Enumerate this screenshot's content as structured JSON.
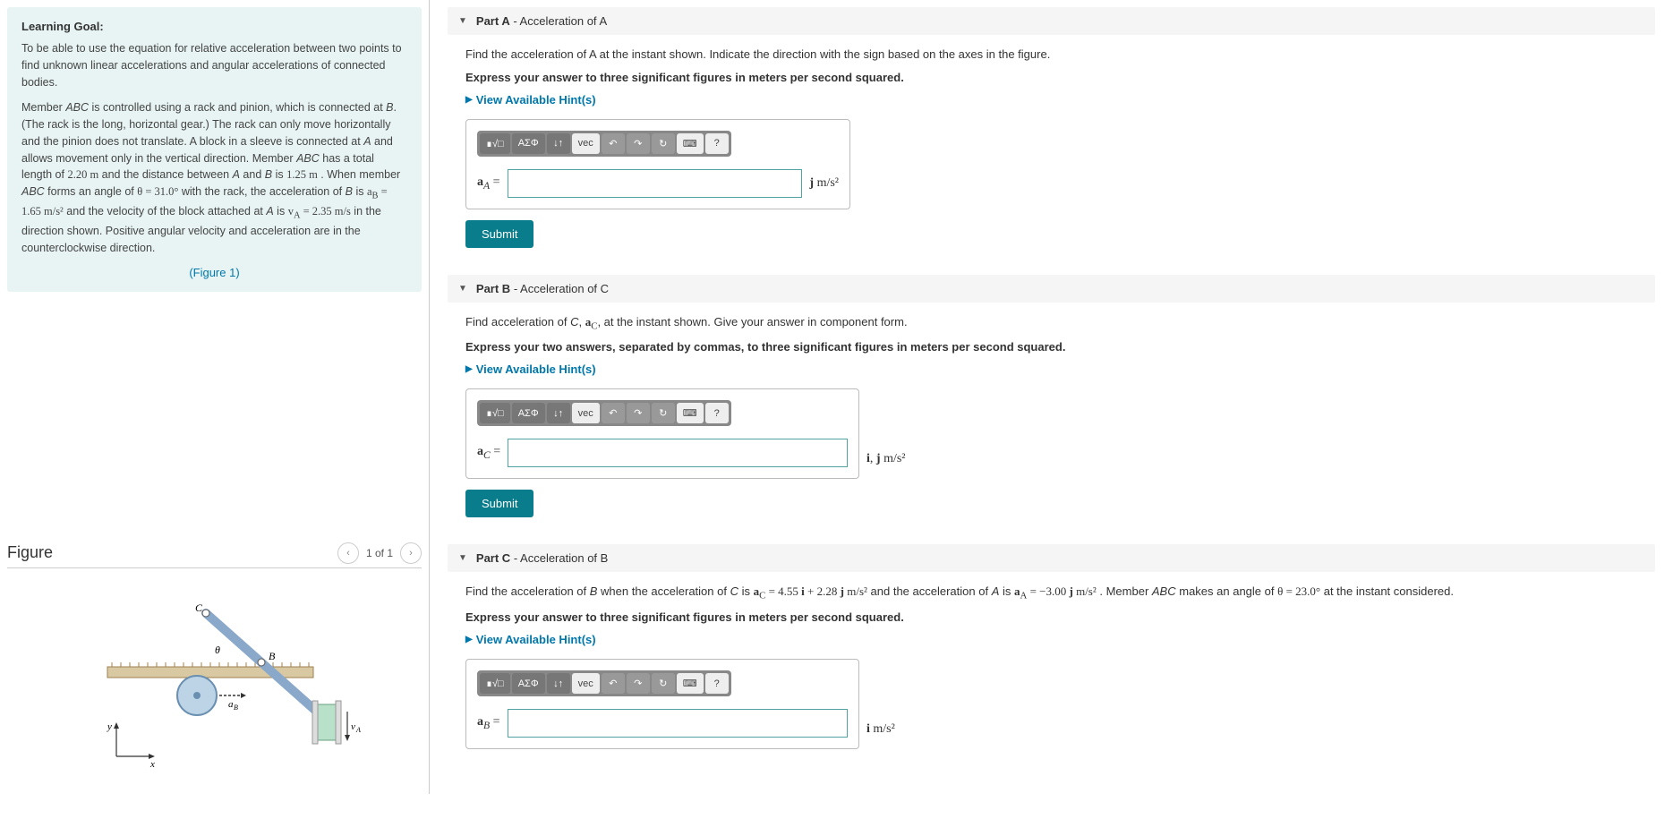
{
  "learning_goal": {
    "heading": "Learning Goal:",
    "p1": "To be able to use the equation for relative acceleration between two points to find unknown linear accelerations and angular accelerations of connected bodies.",
    "p2_html": "Member <i>ABC</i> is controlled using a rack and pinion, which is connected at <i>B</i>. (The rack is the long, horizontal gear.) The rack can only move horizontally and the pinion does not translate. A block in a sleeve is connected at <i>A</i> and allows movement only in the vertical direction. Member <i>ABC</i> has a total length of <span class='math'>2.20 m</span> and the distance between <i>A</i> and <i>B</i> is <span class='math'>1.25 m</span> . When member <i>ABC</i> forms an angle of <span class='math'>θ = 31.0°</span> with the rack, the acceleration of <i>B</i> is <span class='math'>a<sub>B</sub> = 1.65 m/s²</span> and the velocity of the block attached at <i>A</i> is <span class='math'>v<sub>A</sub> = 2.35 m/s</span> in the direction shown. Positive angular velocity and acceleration are in the counterclockwise direction.",
    "figure_link": "(Figure 1)"
  },
  "figure": {
    "title": "Figure",
    "nav_text": "1 of 1"
  },
  "toolbar": {
    "tmpl": "∎√□",
    "greek": "ΑΣΦ",
    "arrows": "↓↑",
    "vec": "vec",
    "undo": "↶",
    "redo": "↷",
    "reset": "↻",
    "kbd": "⌨",
    "help": "?"
  },
  "hints_label": "View Available Hint(s)",
  "submit_label": "Submit",
  "partA": {
    "label": "Part A",
    "title": " - Acceleration of A",
    "prompt": "Find the acceleration of A at the instant shown. Indicate the direction with the sign based on the axes in the figure.",
    "instr": "Express your answer to three significant figures in meters per second squared.",
    "var": "a_A =",
    "unit": "j m/s²"
  },
  "partB": {
    "label": "Part B",
    "title": " - Acceleration of C",
    "prompt_html": "Find acceleration of <i>C</i>, <span class='math'><b>a</b><sub>C</sub></span>, at the instant shown. Give your answer in component form.",
    "instr": "Express your two answers, separated by commas, to three significant figures in meters per second squared.",
    "var": "a_C =",
    "unit": "i, j m/s²"
  },
  "partC": {
    "label": "Part C",
    "title": " - Acceleration of B",
    "prompt_html": "Find the acceleration of <i>B</i> when the acceleration of <i>C</i> is <span class='math'><b>a</b><sub>C</sub> = 4.55 <b>i</b> + 2.28 <b>j</b> m/s²</span> and the acceleration of <i>A</i> is <span class='math'><b>a</b><sub>A</sub> = −3.00 <b>j</b> m/s²</span> . Member <i>ABC</i> makes an angle of <span class='math'>θ = 23.0°</span> at the instant considered.",
    "instr": "Express your answer to three significant figures in meters per second squared.",
    "var": "a_B =",
    "unit": "i m/s²"
  }
}
